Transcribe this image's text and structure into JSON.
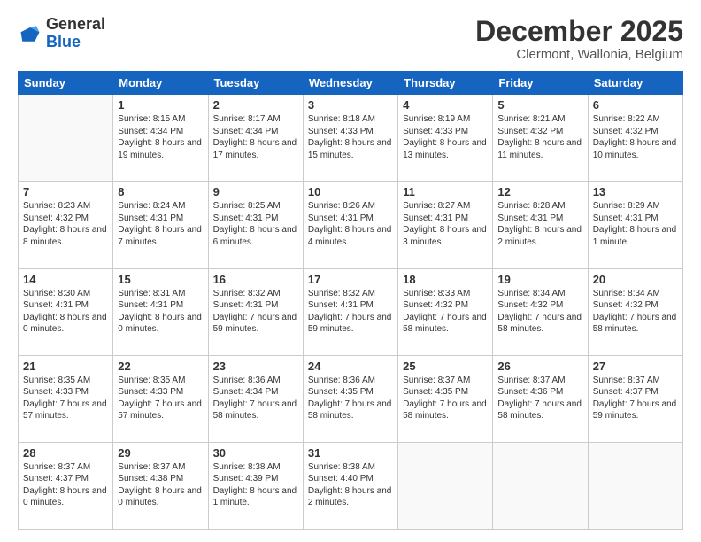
{
  "logo": {
    "line1": "General",
    "line2": "Blue"
  },
  "header": {
    "month": "December 2025",
    "location": "Clermont, Wallonia, Belgium"
  },
  "days_of_week": [
    "Sunday",
    "Monday",
    "Tuesday",
    "Wednesday",
    "Thursday",
    "Friday",
    "Saturday"
  ],
  "weeks": [
    [
      {
        "day": "",
        "sunrise": "",
        "sunset": "",
        "daylight": ""
      },
      {
        "day": "1",
        "sunrise": "Sunrise: 8:15 AM",
        "sunset": "Sunset: 4:34 PM",
        "daylight": "Daylight: 8 hours and 19 minutes."
      },
      {
        "day": "2",
        "sunrise": "Sunrise: 8:17 AM",
        "sunset": "Sunset: 4:34 PM",
        "daylight": "Daylight: 8 hours and 17 minutes."
      },
      {
        "day": "3",
        "sunrise": "Sunrise: 8:18 AM",
        "sunset": "Sunset: 4:33 PM",
        "daylight": "Daylight: 8 hours and 15 minutes."
      },
      {
        "day": "4",
        "sunrise": "Sunrise: 8:19 AM",
        "sunset": "Sunset: 4:33 PM",
        "daylight": "Daylight: 8 hours and 13 minutes."
      },
      {
        "day": "5",
        "sunrise": "Sunrise: 8:21 AM",
        "sunset": "Sunset: 4:32 PM",
        "daylight": "Daylight: 8 hours and 11 minutes."
      },
      {
        "day": "6",
        "sunrise": "Sunrise: 8:22 AM",
        "sunset": "Sunset: 4:32 PM",
        "daylight": "Daylight: 8 hours and 10 minutes."
      }
    ],
    [
      {
        "day": "7",
        "sunrise": "Sunrise: 8:23 AM",
        "sunset": "Sunset: 4:32 PM",
        "daylight": "Daylight: 8 hours and 8 minutes."
      },
      {
        "day": "8",
        "sunrise": "Sunrise: 8:24 AM",
        "sunset": "Sunset: 4:31 PM",
        "daylight": "Daylight: 8 hours and 7 minutes."
      },
      {
        "day": "9",
        "sunrise": "Sunrise: 8:25 AM",
        "sunset": "Sunset: 4:31 PM",
        "daylight": "Daylight: 8 hours and 6 minutes."
      },
      {
        "day": "10",
        "sunrise": "Sunrise: 8:26 AM",
        "sunset": "Sunset: 4:31 PM",
        "daylight": "Daylight: 8 hours and 4 minutes."
      },
      {
        "day": "11",
        "sunrise": "Sunrise: 8:27 AM",
        "sunset": "Sunset: 4:31 PM",
        "daylight": "Daylight: 8 hours and 3 minutes."
      },
      {
        "day": "12",
        "sunrise": "Sunrise: 8:28 AM",
        "sunset": "Sunset: 4:31 PM",
        "daylight": "Daylight: 8 hours and 2 minutes."
      },
      {
        "day": "13",
        "sunrise": "Sunrise: 8:29 AM",
        "sunset": "Sunset: 4:31 PM",
        "daylight": "Daylight: 8 hours and 1 minute."
      }
    ],
    [
      {
        "day": "14",
        "sunrise": "Sunrise: 8:30 AM",
        "sunset": "Sunset: 4:31 PM",
        "daylight": "Daylight: 8 hours and 0 minutes."
      },
      {
        "day": "15",
        "sunrise": "Sunrise: 8:31 AM",
        "sunset": "Sunset: 4:31 PM",
        "daylight": "Daylight: 8 hours and 0 minutes."
      },
      {
        "day": "16",
        "sunrise": "Sunrise: 8:32 AM",
        "sunset": "Sunset: 4:31 PM",
        "daylight": "Daylight: 7 hours and 59 minutes."
      },
      {
        "day": "17",
        "sunrise": "Sunrise: 8:32 AM",
        "sunset": "Sunset: 4:31 PM",
        "daylight": "Daylight: 7 hours and 59 minutes."
      },
      {
        "day": "18",
        "sunrise": "Sunrise: 8:33 AM",
        "sunset": "Sunset: 4:32 PM",
        "daylight": "Daylight: 7 hours and 58 minutes."
      },
      {
        "day": "19",
        "sunrise": "Sunrise: 8:34 AM",
        "sunset": "Sunset: 4:32 PM",
        "daylight": "Daylight: 7 hours and 58 minutes."
      },
      {
        "day": "20",
        "sunrise": "Sunrise: 8:34 AM",
        "sunset": "Sunset: 4:32 PM",
        "daylight": "Daylight: 7 hours and 58 minutes."
      }
    ],
    [
      {
        "day": "21",
        "sunrise": "Sunrise: 8:35 AM",
        "sunset": "Sunset: 4:33 PM",
        "daylight": "Daylight: 7 hours and 57 minutes."
      },
      {
        "day": "22",
        "sunrise": "Sunrise: 8:35 AM",
        "sunset": "Sunset: 4:33 PM",
        "daylight": "Daylight: 7 hours and 57 minutes."
      },
      {
        "day": "23",
        "sunrise": "Sunrise: 8:36 AM",
        "sunset": "Sunset: 4:34 PM",
        "daylight": "Daylight: 7 hours and 58 minutes."
      },
      {
        "day": "24",
        "sunrise": "Sunrise: 8:36 AM",
        "sunset": "Sunset: 4:35 PM",
        "daylight": "Daylight: 7 hours and 58 minutes."
      },
      {
        "day": "25",
        "sunrise": "Sunrise: 8:37 AM",
        "sunset": "Sunset: 4:35 PM",
        "daylight": "Daylight: 7 hours and 58 minutes."
      },
      {
        "day": "26",
        "sunrise": "Sunrise: 8:37 AM",
        "sunset": "Sunset: 4:36 PM",
        "daylight": "Daylight: 7 hours and 58 minutes."
      },
      {
        "day": "27",
        "sunrise": "Sunrise: 8:37 AM",
        "sunset": "Sunset: 4:37 PM",
        "daylight": "Daylight: 7 hours and 59 minutes."
      }
    ],
    [
      {
        "day": "28",
        "sunrise": "Sunrise: 8:37 AM",
        "sunset": "Sunset: 4:37 PM",
        "daylight": "Daylight: 8 hours and 0 minutes."
      },
      {
        "day": "29",
        "sunrise": "Sunrise: 8:37 AM",
        "sunset": "Sunset: 4:38 PM",
        "daylight": "Daylight: 8 hours and 0 minutes."
      },
      {
        "day": "30",
        "sunrise": "Sunrise: 8:38 AM",
        "sunset": "Sunset: 4:39 PM",
        "daylight": "Daylight: 8 hours and 1 minute."
      },
      {
        "day": "31",
        "sunrise": "Sunrise: 8:38 AM",
        "sunset": "Sunset: 4:40 PM",
        "daylight": "Daylight: 8 hours and 2 minutes."
      },
      {
        "day": "",
        "sunrise": "",
        "sunset": "",
        "daylight": ""
      },
      {
        "day": "",
        "sunrise": "",
        "sunset": "",
        "daylight": ""
      },
      {
        "day": "",
        "sunrise": "",
        "sunset": "",
        "daylight": ""
      }
    ]
  ]
}
